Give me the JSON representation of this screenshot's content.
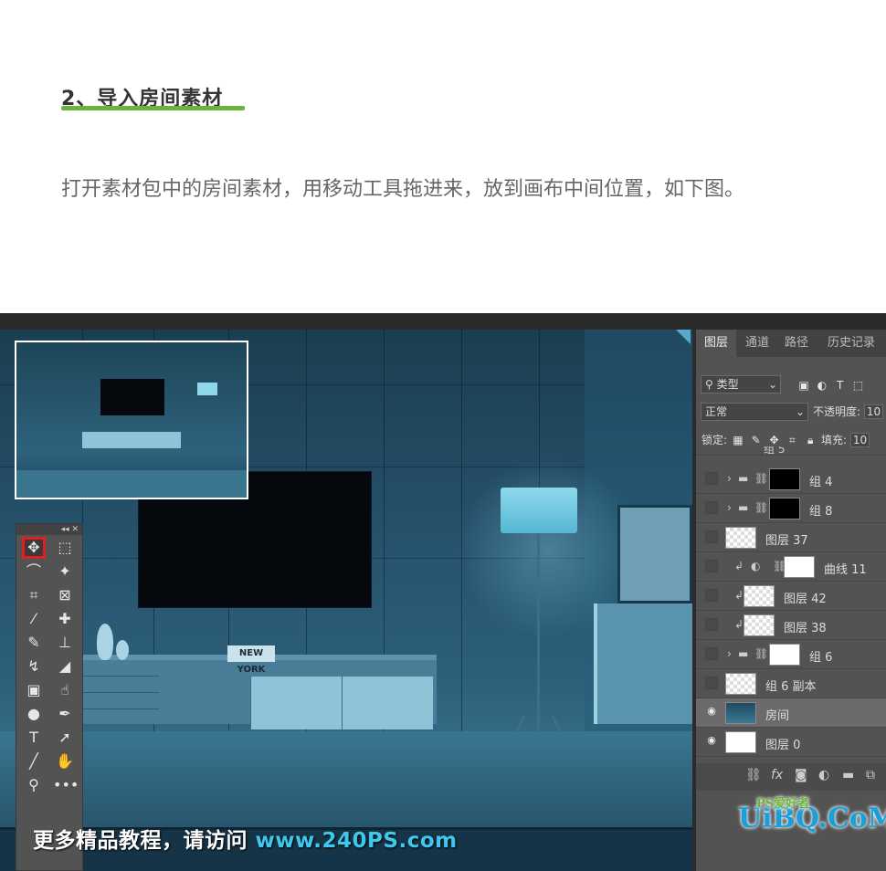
{
  "article": {
    "heading": "2、导入房间素材",
    "body": "打开素材包中的房间素材，用移动工具拖进来，放到画布中间位置，如下图。"
  },
  "canvas": {
    "books_label": "NEW YORK"
  },
  "toolbox": {
    "collapse_label": "◂◂ ✕",
    "tools": [
      {
        "name": "move-tool-icon",
        "glyph": "✥",
        "active": true
      },
      {
        "name": "marquee-tool-icon",
        "glyph": "⬚"
      },
      {
        "name": "lasso-tool-icon",
        "glyph": "⌒"
      },
      {
        "name": "magic-wand-tool-icon",
        "glyph": "✦"
      },
      {
        "name": "crop-tool-icon",
        "glyph": "⌗"
      },
      {
        "name": "frame-tool-icon",
        "glyph": "⊠"
      },
      {
        "name": "eyedropper-tool-icon",
        "glyph": "⁄"
      },
      {
        "name": "healing-brush-tool-icon",
        "glyph": "✚"
      },
      {
        "name": "brush-tool-icon",
        "glyph": "✎"
      },
      {
        "name": "stamp-tool-icon",
        "glyph": "⊥"
      },
      {
        "name": "history-brush-tool-icon",
        "glyph": "↯"
      },
      {
        "name": "eraser-tool-icon",
        "glyph": "◢"
      },
      {
        "name": "gradient-tool-icon",
        "glyph": "▣"
      },
      {
        "name": "smudge-tool-icon",
        "glyph": "☝"
      },
      {
        "name": "dodge-tool-icon",
        "glyph": "●"
      },
      {
        "name": "pen-tool-icon",
        "glyph": "✒"
      },
      {
        "name": "type-tool-icon",
        "glyph": "T"
      },
      {
        "name": "path-selection-tool-icon",
        "glyph": "➚"
      },
      {
        "name": "line-tool-icon",
        "glyph": "╱"
      },
      {
        "name": "hand-tool-icon",
        "glyph": "✋"
      },
      {
        "name": "zoom-tool-icon",
        "glyph": "⚲"
      },
      {
        "name": "more-tools-icon",
        "glyph": "•••"
      }
    ]
  },
  "watermark": {
    "text": "更多精品教程，请访问",
    "url": "www.240PS.com"
  },
  "panel": {
    "tabs": [
      "图层",
      "通道",
      "路径",
      "历史记录"
    ],
    "filter_label": "类型",
    "blend_mode": "正常",
    "opacity_label": "不透明度:",
    "opacity_value": "10",
    "lock_label": "锁定:",
    "fill_label": "填充:",
    "fill_value": "10",
    "partial_layer": "组 5",
    "layers": [
      {
        "name": "组 4",
        "type": "group",
        "visible": false
      },
      {
        "name": "组 8",
        "type": "group",
        "visible": false
      },
      {
        "name": "图层 37",
        "type": "layer",
        "visible": false
      },
      {
        "name": "曲线 11",
        "type": "adjustment",
        "visible": false
      },
      {
        "name": "图层 42",
        "type": "layer",
        "visible": false
      },
      {
        "name": "图层 38",
        "type": "layer",
        "visible": false
      },
      {
        "name": "组 6",
        "type": "group",
        "visible": false
      },
      {
        "name": "组 6 副本",
        "type": "layer",
        "visible": false
      },
      {
        "name": "房间",
        "type": "layer",
        "visible": true,
        "selected": true
      },
      {
        "name": "图层 0",
        "type": "layer",
        "visible": true
      }
    ],
    "bottom_icons": [
      "link-icon",
      "fx-icon",
      "mask-icon",
      "adjustment-icon",
      "folder-icon",
      "new-layer-icon"
    ],
    "fx_label": "fx"
  },
  "logo": {
    "text": "UiBQ.CoM",
    "sub": "PS爱好者"
  }
}
